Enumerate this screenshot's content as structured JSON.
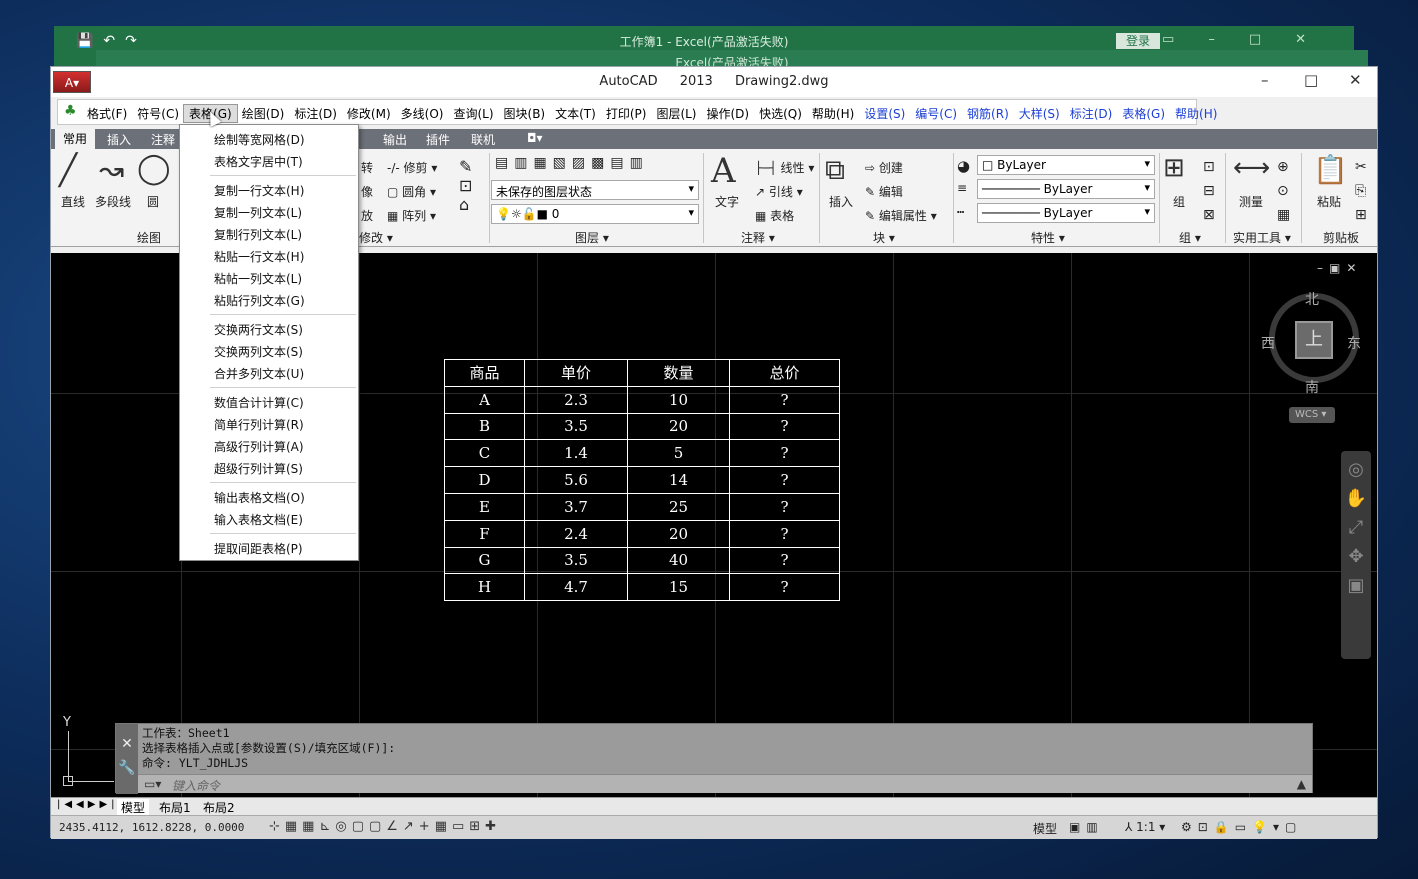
{
  "excel_back": {
    "title": "工作簿1  -  Excel(产品激活失败)",
    "login": "登录",
    "second_title": "Excel(产品激活失败)"
  },
  "window": {
    "app_name": "AutoCAD 2013",
    "file": "Drawing2.dwg"
  },
  "menubar": {
    "items": [
      {
        "label": "格式(F)"
      },
      {
        "label": "符号(C)"
      },
      {
        "label": "表格(G)"
      },
      {
        "label": "绘图(D)"
      },
      {
        "label": "标注(D)"
      },
      {
        "label": "修改(M)"
      },
      {
        "label": "多线(O)"
      },
      {
        "label": "查询(L)"
      },
      {
        "label": "图块(B)"
      },
      {
        "label": "文本(T)"
      },
      {
        "label": "打印(P)"
      },
      {
        "label": "图层(L)"
      },
      {
        "label": "操作(D)"
      },
      {
        "label": "快选(Q)"
      },
      {
        "label": "帮助(H)"
      },
      {
        "label": "设置(S)"
      },
      {
        "label": "编号(C)"
      },
      {
        "label": "钢筋(R)"
      },
      {
        "label": "大样(S)"
      },
      {
        "label": "标注(D)"
      },
      {
        "label": "表格(G)"
      },
      {
        "label": "帮助(H)"
      }
    ]
  },
  "ribbon_tabs": [
    "常用",
    "插入",
    "注释",
    "输出",
    "插件",
    "联机"
  ],
  "ribbon": {
    "draw_tools": [
      "直线",
      "多段线",
      "圆"
    ],
    "modify": [
      "转",
      "修剪",
      "圆角",
      "阵列",
      "像",
      "放"
    ],
    "layer_state": "未保存的图层状态",
    "layer_current": "0",
    "text_label": "文字",
    "annotate": [
      "线性",
      "引线",
      "表格"
    ],
    "insert_label": "插入",
    "block": [
      "创建",
      "编辑",
      "编辑属性"
    ],
    "bylayer": [
      "ByLayer",
      "ByLayer",
      "ByLayer"
    ],
    "group_label": "组",
    "measure_label": "测量",
    "paste_label": "粘贴",
    "panels": [
      "绘图",
      "修改",
      "图层",
      "注释",
      "块",
      "特性",
      "组",
      "实用工具",
      "剪贴板"
    ]
  },
  "dropdown": {
    "groups": [
      [
        "绘制等宽网格(D)",
        "表格文字居中(T)"
      ],
      [
        "复制一行文本(H)",
        "复制一列文本(L)",
        "复制行列文本(L)",
        "粘贴一行文本(H)",
        "粘帖一列文本(L)",
        "粘贴行列文本(G)"
      ],
      [
        "交换两行文本(S)",
        "交换两列文本(S)",
        "合并多列文本(U)"
      ],
      [
        "数值合计计算(C)",
        "简单行列计算(R)",
        "高级行列计算(A)",
        "超级行列计算(S)"
      ],
      [
        "输出表格文档(O)",
        "输入表格文档(E)"
      ],
      [
        "提取间距表格(P)"
      ]
    ]
  },
  "table": {
    "headers": [
      "商品",
      "单价",
      "数量",
      "总价"
    ],
    "rows": [
      [
        "A",
        "2.3",
        "10",
        "?"
      ],
      [
        "B",
        "3.5",
        "20",
        "?"
      ],
      [
        "C",
        "1.4",
        "5",
        "?"
      ],
      [
        "D",
        "5.6",
        "14",
        "?"
      ],
      [
        "E",
        "3.7",
        "25",
        "?"
      ],
      [
        "F",
        "2.4",
        "20",
        "?"
      ],
      [
        "G",
        "3.5",
        "40",
        "?"
      ],
      [
        "H",
        "4.7",
        "15",
        "?"
      ]
    ]
  },
  "viewcube": {
    "north": "北",
    "south": "南",
    "east": "东",
    "west": "西",
    "face": "上",
    "wcs": "WCS"
  },
  "ucs": {
    "y": "Y"
  },
  "command": {
    "lines": [
      "工作表：Sheet1",
      "选择表格插入点或[参数设置(S)/填充区域(F)]:",
      "命令: YLT_JDHLJS"
    ],
    "placeholder": "键入命令"
  },
  "layout_tabs": [
    "模型",
    "布局1",
    "布局2"
  ],
  "status": {
    "coords": "2435.4112, 1612.8228, 0.0000",
    "model": "模型",
    "scale": "1:1"
  }
}
